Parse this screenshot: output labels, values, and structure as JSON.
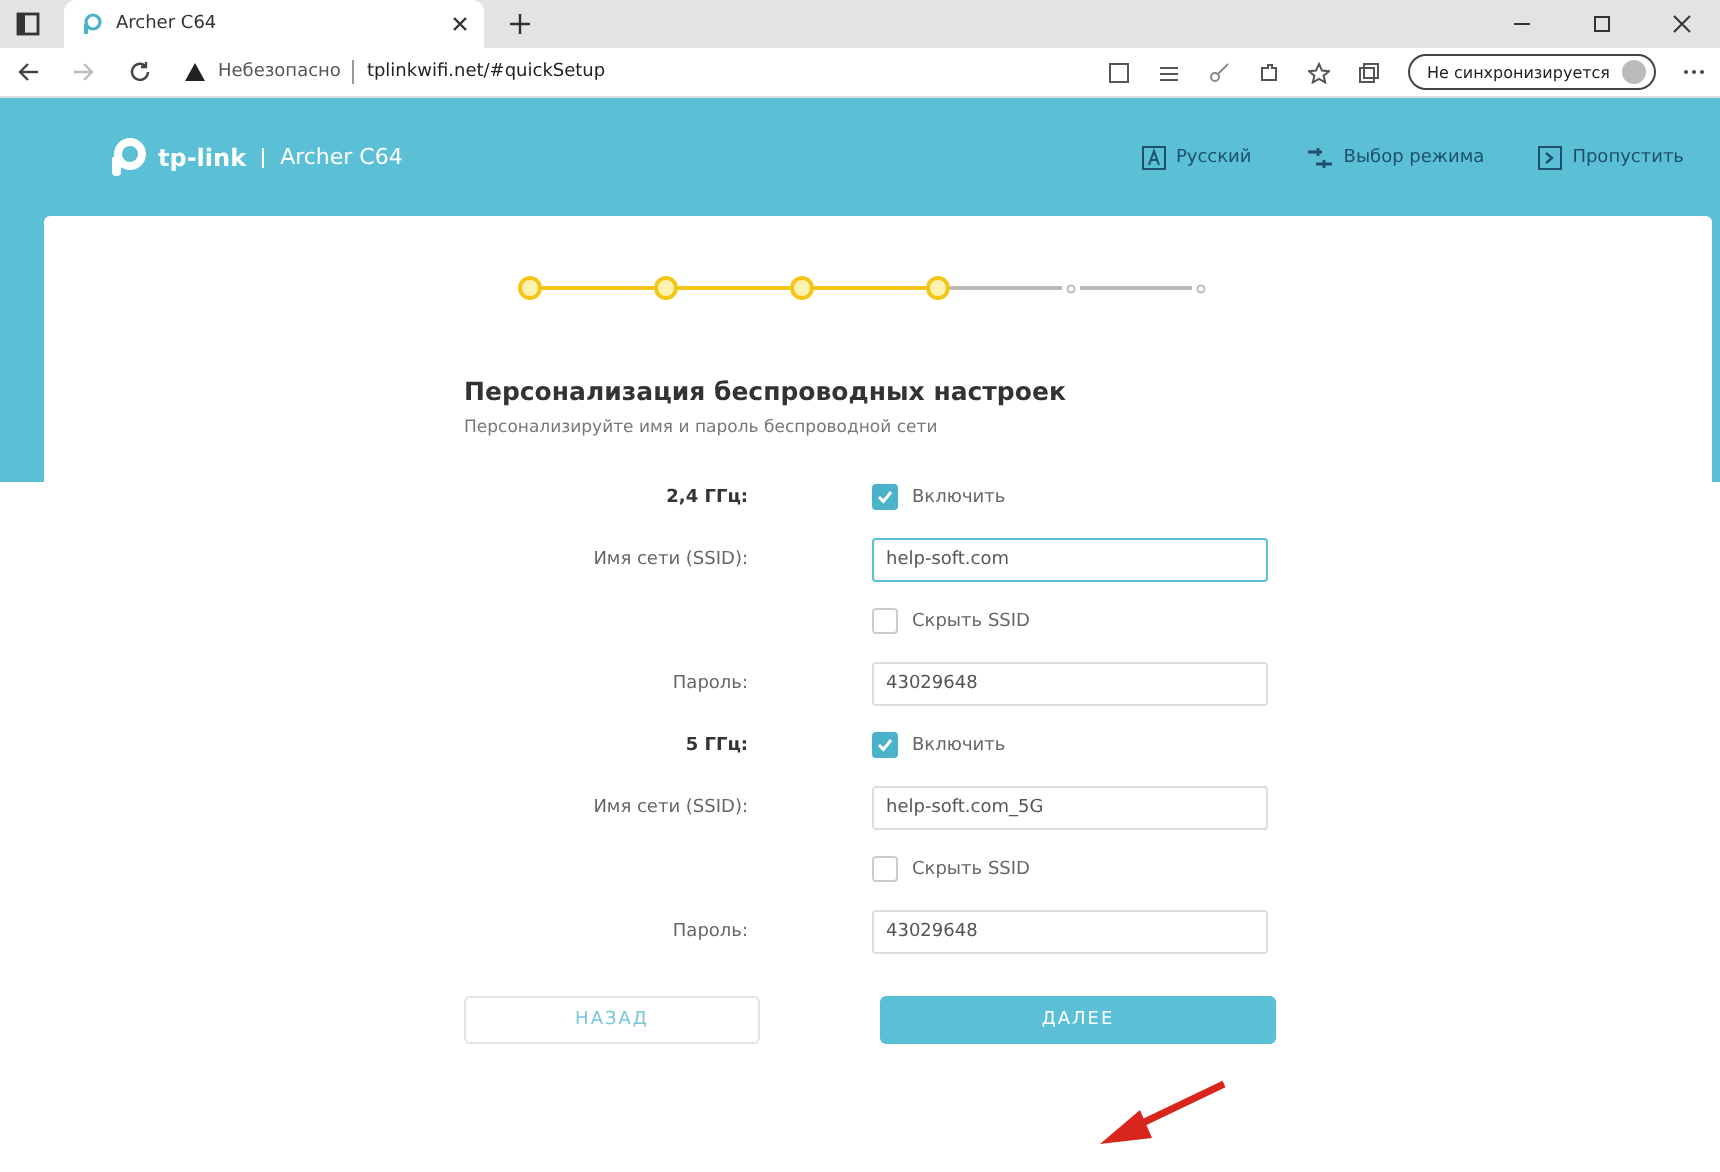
{
  "browser": {
    "tab_title": "Archer C64",
    "security": "Небезопасно",
    "url": "tplinkwifi.net/#quickSetup",
    "sync": "Не синхронизируется"
  },
  "header": {
    "brand": "tp-link",
    "model": "Archer C64",
    "actions": [
      {
        "kind": "language",
        "label": "Русский"
      },
      {
        "kind": "mode",
        "label": "Выбор режима"
      },
      {
        "kind": "skip",
        "label": "Пропустить"
      }
    ]
  },
  "steps": [
    {
      "done": true
    },
    {
      "done": true
    },
    {
      "done": true
    },
    {
      "done": true
    },
    {
      "done": false
    },
    {
      "done": false
    }
  ],
  "title": "Персонализация беспроводных настроек",
  "subtitle": "Персонализируйте имя и пароль беспроводной сети",
  "bands": [
    {
      "label": "2,4 ГГц:",
      "enable_label": "Включить",
      "enabled": true,
      "ssid_label": "Имя сети (SSID):",
      "ssid": "help-soft.com",
      "hide_label": "Скрыть SSID",
      "hidden": false,
      "password_label": "Пароль:",
      "password": "43029648"
    },
    {
      "label": "5 ГГц:",
      "enable_label": "Включить",
      "enabled": true,
      "ssid_label": "Имя сети (SSID):",
      "ssid": "help-soft.com_5G",
      "hide_label": "Скрыть SSID",
      "hidden": false,
      "password_label": "Пароль:",
      "password": "43029648"
    }
  ],
  "buttons": [
    {
      "kind": "back",
      "label": "НАЗАД"
    },
    {
      "kind": "next",
      "label": "ДАЛЕЕ"
    }
  ]
}
